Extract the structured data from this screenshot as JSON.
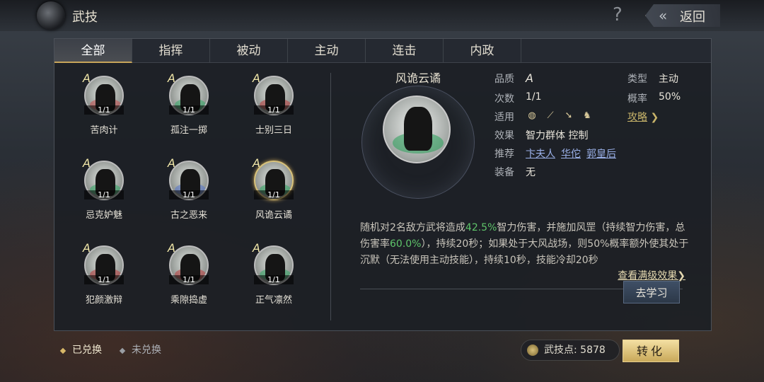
{
  "header": {
    "title": "武技",
    "help_icon": "question-icon",
    "back_label": "返回"
  },
  "tabs": [
    "全部",
    "指挥",
    "被动",
    "主动",
    "连击",
    "内政"
  ],
  "active_tab": "全部",
  "skills": [
    {
      "name": "苦肉计",
      "grade": "A",
      "count": "1/1",
      "glow": "#c25555"
    },
    {
      "name": "孤注一掷",
      "grade": "A",
      "count": "1/1",
      "glow": "#3aa86a"
    },
    {
      "name": "士别三日",
      "grade": "A",
      "count": "1/1",
      "glow": "#b84444"
    },
    {
      "name": "忌克妒魅",
      "grade": "A",
      "count": "1/1",
      "glow": "#3aa86a"
    },
    {
      "name": "古之恶来",
      "grade": "A",
      "count": "1/1",
      "glow": "#5a78c8"
    },
    {
      "name": "风诡云谲",
      "grade": "A",
      "count": "1/1",
      "glow": "#3aa86a"
    },
    {
      "name": "犯颜激辩",
      "grade": "A",
      "count": "1/1",
      "glow": "#b84444"
    },
    {
      "name": "乘隙捣虚",
      "grade": "A",
      "count": "1/1",
      "glow": "#b84444"
    },
    {
      "name": "正气凛然",
      "grade": "A",
      "count": "1/1",
      "glow": "#3aa86a"
    }
  ],
  "detail": {
    "name": "风诡云谲",
    "labels": {
      "quality": "品质",
      "type": "类型",
      "times": "次数",
      "prob": "概率",
      "apply": "适用",
      "guide": "攻略",
      "effect": "效果",
      "recommend": "推荐",
      "equip": "装备"
    },
    "quality": "A",
    "type": "主动",
    "times": "1/1",
    "prob": "50%",
    "apply_icons": [
      "shield-icon",
      "bow-icon",
      "spear-icon",
      "horse-icon"
    ],
    "guide_arrow": "❯",
    "effect": "智力群体 控制",
    "recommend": [
      "卞夫人",
      "华佗",
      "郭皇后"
    ],
    "equip": "无",
    "desc": {
      "a": "随机对2名敌方武将造成",
      "b": "42.5%",
      "c": "智力伤害，并施加风罡（持续智力伤害，总伤害率",
      "d": "60.0%",
      "e": "），持续20秒；如果处于大风战场，则50%概率额外使其处于沉默（无法使用主动技能），持续10秒，技能冷却20秒"
    },
    "more_label": "查看满级效果❯",
    "learn_label": "去学习"
  },
  "footer": {
    "exchanged": "已兑换",
    "not_exchanged": "未兑换",
    "points_label": "武技点:",
    "points_value": "5878",
    "convert_label": "转化"
  }
}
